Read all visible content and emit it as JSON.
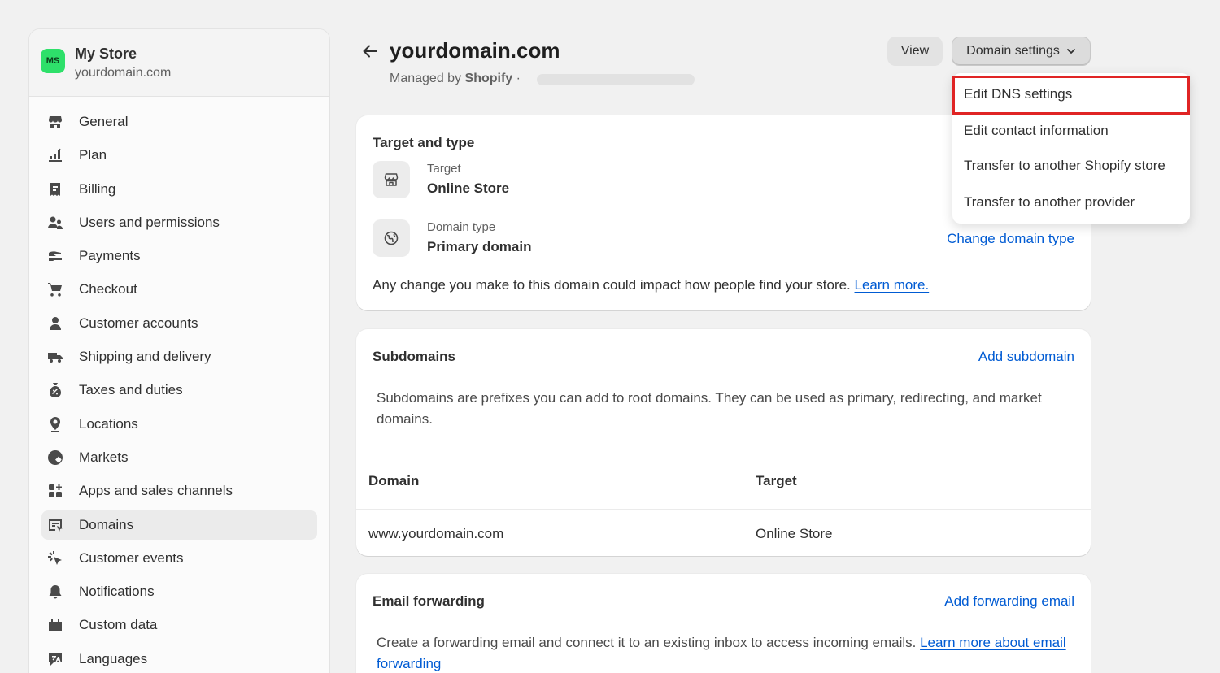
{
  "store": {
    "initials": "MS",
    "name": "My Store",
    "domain": "yourdomain.com"
  },
  "nav": [
    {
      "label": "General",
      "icon": "store-icon"
    },
    {
      "label": "Plan",
      "icon": "plan-icon"
    },
    {
      "label": "Billing",
      "icon": "billing-icon"
    },
    {
      "label": "Users and permissions",
      "icon": "users-icon"
    },
    {
      "label": "Payments",
      "icon": "payments-icon"
    },
    {
      "label": "Checkout",
      "icon": "cart-icon"
    },
    {
      "label": "Customer accounts",
      "icon": "person-icon"
    },
    {
      "label": "Shipping and delivery",
      "icon": "truck-icon"
    },
    {
      "label": "Taxes and duties",
      "icon": "taxes-icon"
    },
    {
      "label": "Locations",
      "icon": "location-icon"
    },
    {
      "label": "Markets",
      "icon": "globe-icon"
    },
    {
      "label": "Apps and sales channels",
      "icon": "apps-icon"
    },
    {
      "label": "Domains",
      "icon": "domains-icon",
      "active": true
    },
    {
      "label": "Customer events",
      "icon": "cursor-click-icon"
    },
    {
      "label": "Notifications",
      "icon": "bell-icon"
    },
    {
      "label": "Custom data",
      "icon": "custom-data-icon"
    },
    {
      "label": "Languages",
      "icon": "languages-icon"
    }
  ],
  "header": {
    "title": "yourdomain.com",
    "managed_prefix": "Managed by",
    "managed_by": "Shopify",
    "managed_suffix": "·",
    "view_label": "View",
    "domain_settings_label": "Domain settings"
  },
  "dropdown": {
    "items": [
      "Edit DNS settings",
      "Edit contact information",
      "Transfer to another Shopify store",
      "Transfer to another provider"
    ],
    "highlighted_index": 0
  },
  "target_card": {
    "title": "Target and type",
    "target_label": "Target",
    "target_value": "Online Store",
    "type_label": "Domain type",
    "type_value": "Primary domain",
    "change_link": "Change domain type",
    "notice": "Any change you make to this domain could impact how people find your store.",
    "learn_more": "Learn more."
  },
  "subdomains_card": {
    "title": "Subdomains",
    "add_link": "Add subdomain",
    "description": "Subdomains are prefixes you can add to root domains. They can be used as primary, redirecting, and market domains.",
    "columns": [
      "Domain",
      "Target"
    ],
    "rows": [
      {
        "domain": "www.yourdomain.com",
        "target": "Online Store"
      }
    ]
  },
  "email_card": {
    "title": "Email forwarding",
    "add_link": "Add forwarding email",
    "description": "Create a forwarding email and connect it to an existing inbox to access incoming emails.",
    "learn_more": "Learn more about email forwarding"
  },
  "colors": {
    "link": "#005bd3",
    "highlight": "#e02424",
    "avatar": "#2ee06a"
  }
}
